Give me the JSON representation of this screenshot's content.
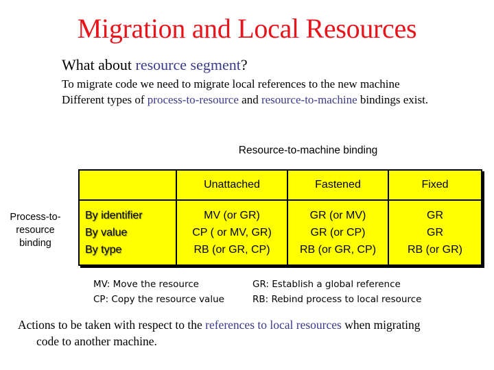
{
  "slide": {
    "title": "Migration and Local Resources",
    "question": {
      "prefix": "What about ",
      "highlight": "resource segment",
      "suffix": "?"
    },
    "paragraph1": "To migrate code we need to migrate local references to the new machine",
    "paragraph2": {
      "prefix": "Different types of ",
      "highlight1": "process-to-resource",
      "middle": " and ",
      "highlight2": "resource-to-machine",
      "suffix": " bindings exist."
    },
    "colors": {
      "title": "#e8141c",
      "highlight": "#3a3a8a",
      "table_fill": "#ffff00"
    }
  },
  "table": {
    "column_group_label": "Resource-to-machine binding",
    "row_group_label": "Process-to- resource binding",
    "headers": [
      "",
      "Unattached",
      "Fastened",
      "Fixed"
    ],
    "row_kinds": [
      "By identifier",
      "By value",
      "By type"
    ],
    "columns": [
      {
        "name": "Unattached",
        "cells": [
          "MV (or GR)",
          "CP ( or MV, GR)",
          "RB (or GR, CP)"
        ]
      },
      {
        "name": "Fastened",
        "cells": [
          "GR (or MV)",
          "GR (or CP)",
          "RB (or GR, CP)"
        ]
      },
      {
        "name": "Fixed",
        "cells": [
          "GR",
          "GR",
          "RB (or GR)"
        ]
      }
    ]
  },
  "legend": {
    "mv": "MV: Move the resource",
    "gr": "GR: Establish a global reference",
    "cp": "CP: Copy the resource value",
    "rb": "RB: Rebind process to local resource"
  },
  "caption": {
    "prefix": "Actions to be taken with respect to the ",
    "highlight": "references to local resources",
    "suffix_line1": " when migrating",
    "line2": "code to another machine."
  }
}
